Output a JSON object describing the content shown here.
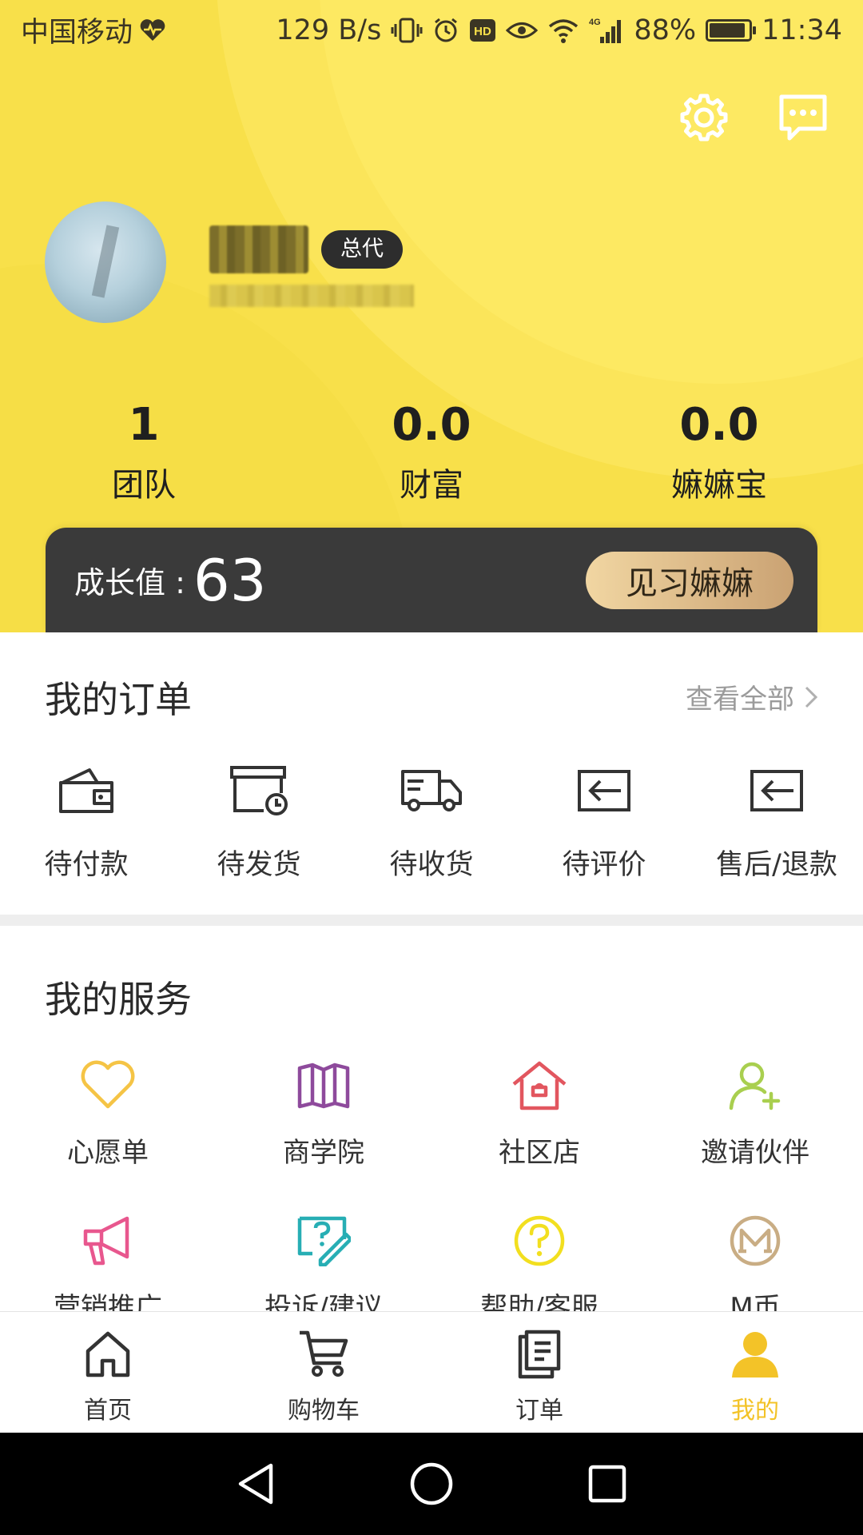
{
  "status_bar": {
    "carrier": "中国移动",
    "net_speed": "129 B/s",
    "network": "4G",
    "battery": "88%",
    "battery_level": 0.88,
    "time": "11:34"
  },
  "header": {
    "settings_icon": "gear-icon",
    "message_icon": "chat-bubble-icon"
  },
  "profile": {
    "badge": "总代"
  },
  "stats": [
    {
      "value": "1",
      "label": "团队"
    },
    {
      "value": "0.0",
      "label": "财富"
    },
    {
      "value": "0.0",
      "label": "嫲嫲宝"
    }
  ],
  "growth": {
    "label": "成长值 :",
    "value": "63",
    "level_button": "见习嫲嫲"
  },
  "orders": {
    "title": "我的订单",
    "view_all": "查看全部",
    "items": [
      {
        "label": "待付款",
        "icon": "wallet-icon"
      },
      {
        "label": "待发货",
        "icon": "box-clock-icon"
      },
      {
        "label": "待收货",
        "icon": "truck-icon"
      },
      {
        "label": "待评价",
        "icon": "review-arrow-icon"
      },
      {
        "label": "售后/退款",
        "icon": "refund-arrow-icon"
      }
    ]
  },
  "services": {
    "title": "我的服务",
    "items": [
      {
        "label": "心愿单",
        "icon": "heart-icon",
        "color": "#f5c445"
      },
      {
        "label": "商学院",
        "icon": "book-icon",
        "color": "#8e4a9c"
      },
      {
        "label": "社区店",
        "icon": "house-icon",
        "color": "#e2565f"
      },
      {
        "label": "邀请伙伴",
        "icon": "add-user-icon",
        "color": "#a9cf4f"
      },
      {
        "label": "营销推广",
        "icon": "megaphone-icon",
        "color": "#e8578e"
      },
      {
        "label": "投诉/建议",
        "icon": "feedback-icon",
        "color": "#27aeb4"
      },
      {
        "label": "帮助/客服",
        "icon": "help-icon",
        "color": "#f2df1f"
      },
      {
        "label": "M币",
        "icon": "m-coin-icon",
        "color": "#c9ad84"
      }
    ]
  },
  "tabbar": {
    "active_color": "#f3c328",
    "items": [
      {
        "label": "首页",
        "icon": "home-icon"
      },
      {
        "label": "购物车",
        "icon": "cart-icon"
      },
      {
        "label": "订单",
        "icon": "clipboard-icon"
      },
      {
        "label": "我的",
        "icon": "person-icon"
      }
    ]
  },
  "system_nav": {
    "back": "back-triangle-icon",
    "home": "home-circle-icon",
    "recents": "recents-square-icon"
  }
}
